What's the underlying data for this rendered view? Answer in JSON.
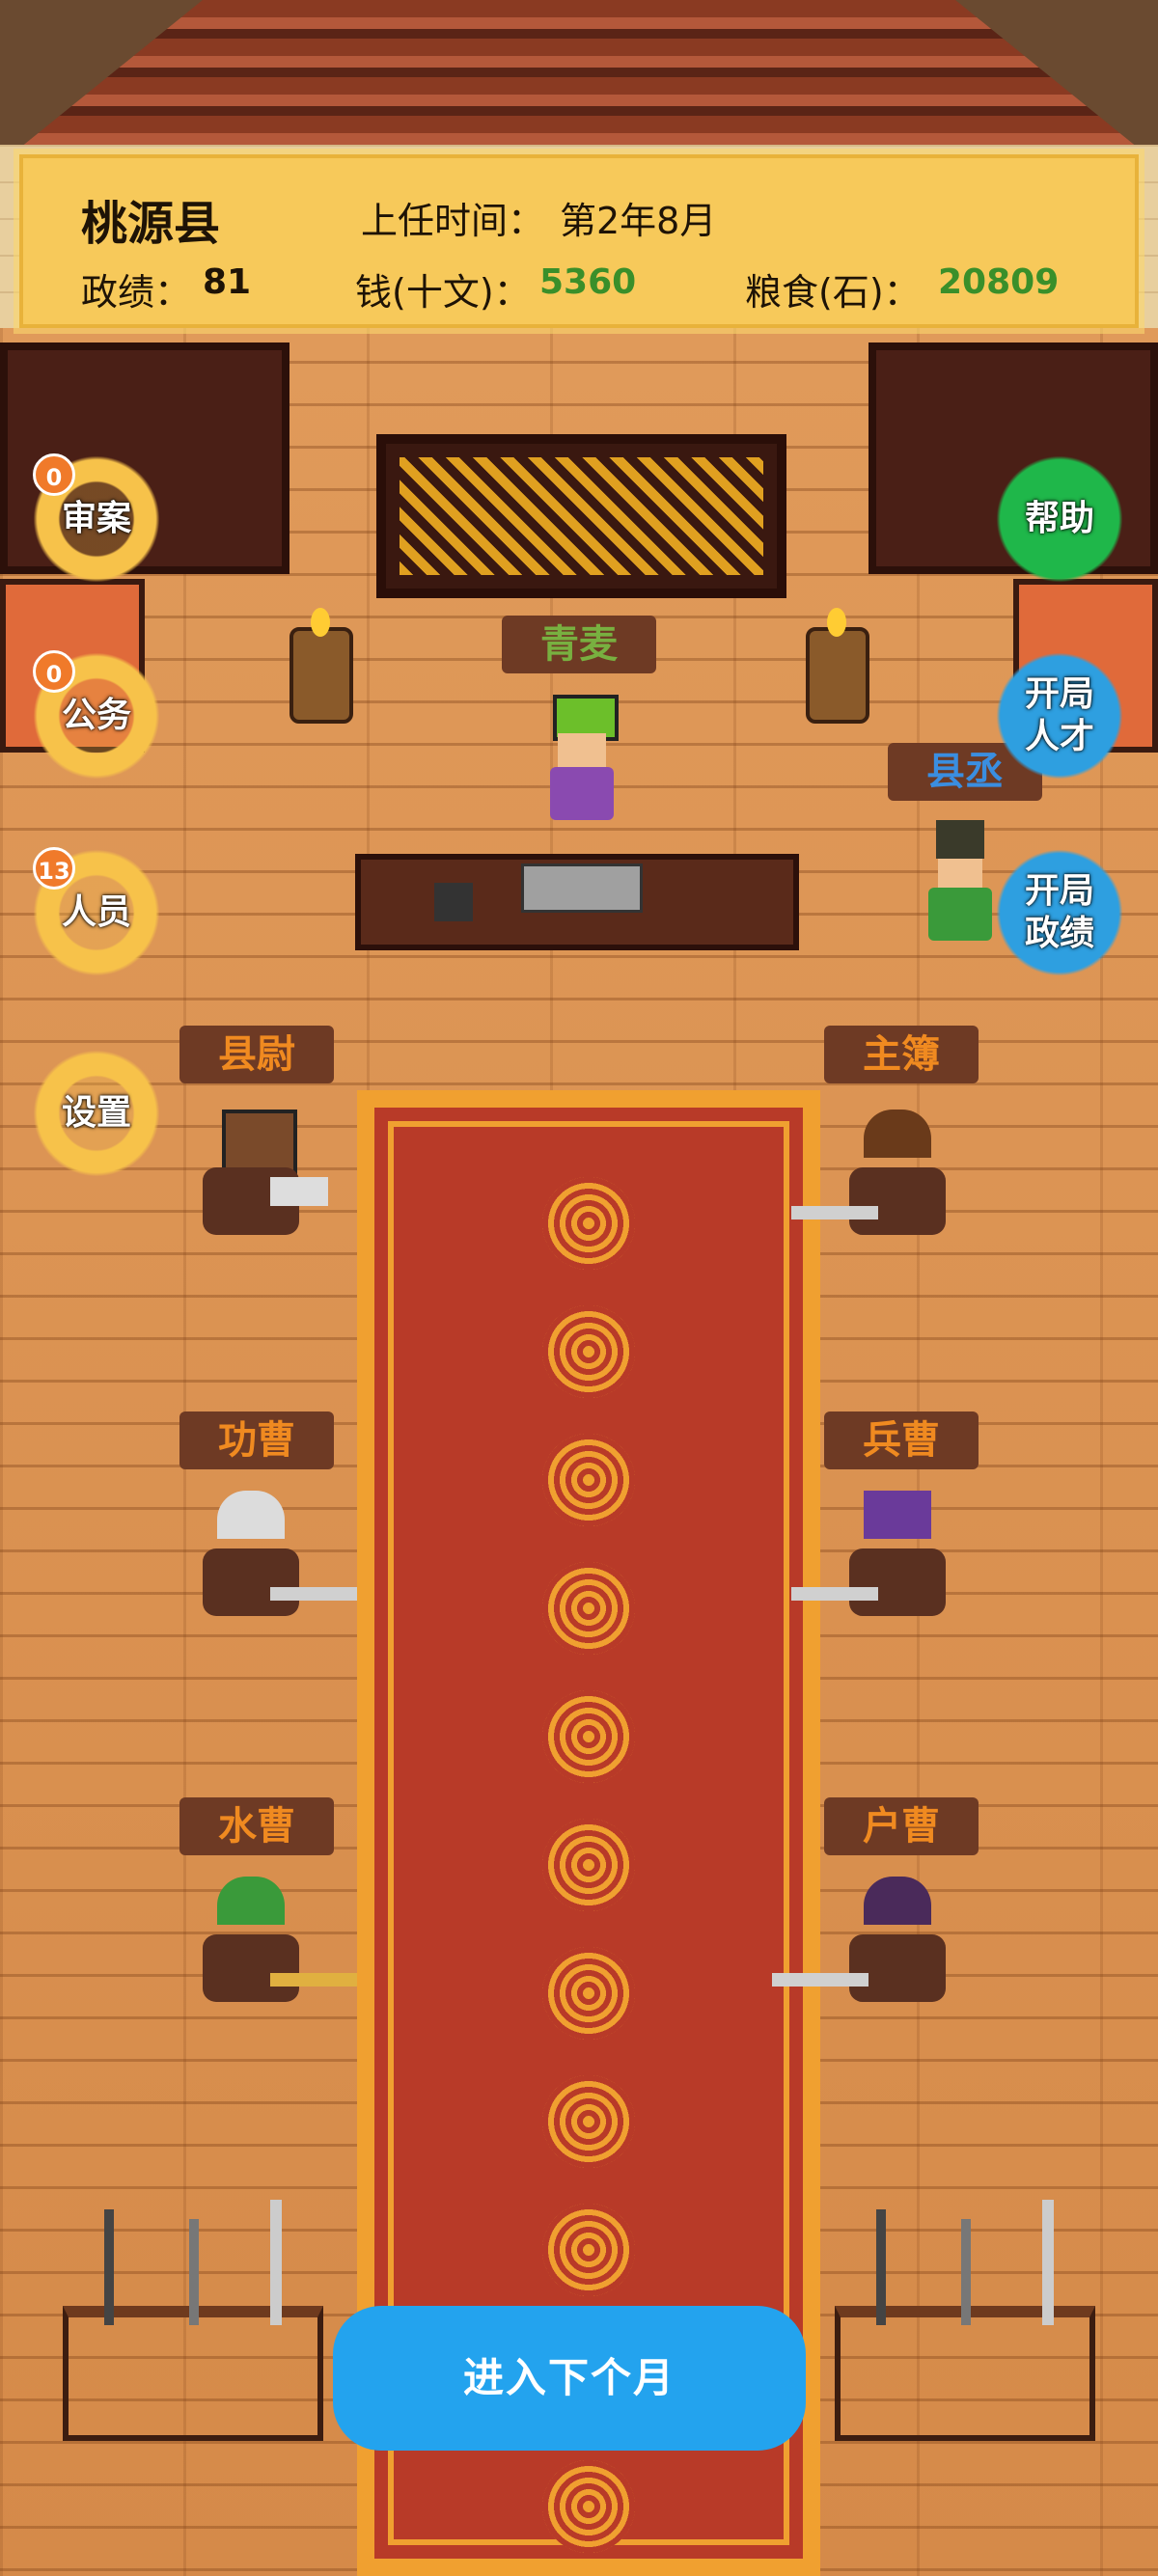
{
  "header": {
    "county": "桃源县",
    "term_label": "上任时间：",
    "term_value": "第2年8月",
    "merit_label": "政绩：",
    "merit_value": "81",
    "money_label": "钱(十文)：",
    "money_value": "5360",
    "grain_label": "粮食(石)：",
    "grain_value": "20809"
  },
  "left_buttons": [
    {
      "label": "审案",
      "badge": "0"
    },
    {
      "label": "公务",
      "badge": "0"
    },
    {
      "label": "人员",
      "badge": "13"
    },
    {
      "label": "设置"
    }
  ],
  "right_buttons": [
    {
      "label": "帮助"
    },
    {
      "label_line1": "开局",
      "label_line2": "人才"
    },
    {
      "label_line1": "开局",
      "label_line2": "政绩"
    }
  ],
  "magistrate_name": "青麦",
  "officials": {
    "deputy": "县丞",
    "left": [
      "县尉",
      "功曹",
      "水曹"
    ],
    "right": [
      "主簿",
      "兵曹",
      "户曹"
    ]
  },
  "next_month_button": "进入下个月",
  "colors": {
    "header_bg": "#f7c95a",
    "value_green": "#3a8f2a",
    "name_green": "#78b040",
    "title_orange": "#f08a20",
    "deputy_blue": "#3a8ee0",
    "button_blue": "#23a3ee"
  }
}
